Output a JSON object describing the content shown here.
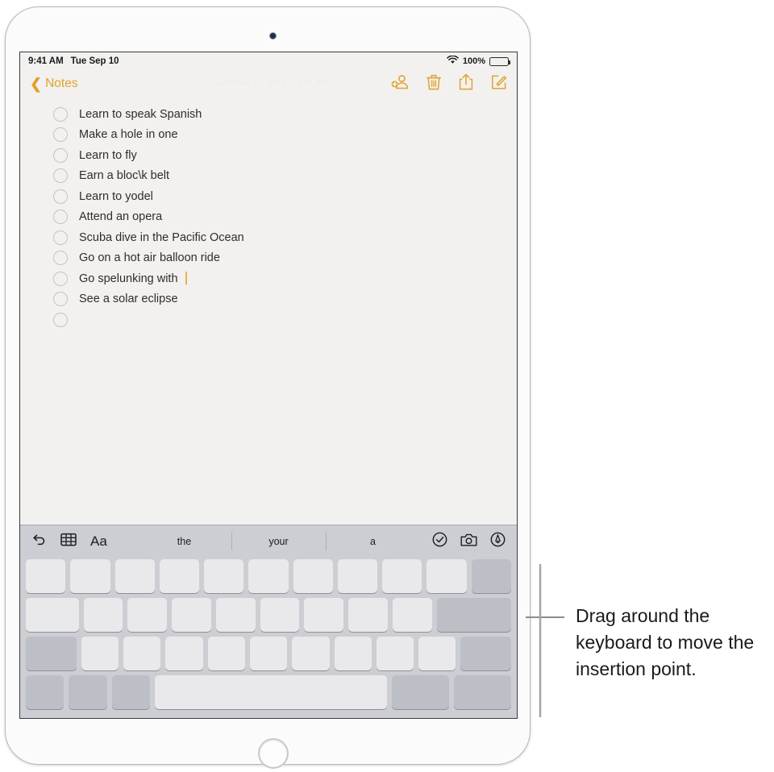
{
  "device": {
    "name": "iPad",
    "front_camera_icon": "camera-dot",
    "home_button_icon": "home-button"
  },
  "status_bar": {
    "time": "9:41 AM",
    "date": "Tue Sep 10",
    "wifi_icon": "wifi-icon",
    "battery_percent": "100%",
    "battery_icon": "battery-full-icon"
  },
  "nav_toolbar": {
    "back_label": "Notes",
    "back_chevron_icon": "chevron-left-icon",
    "accent_color": "#e0a32e",
    "actions": [
      {
        "name": "add-people-button",
        "icon": "add-person-icon"
      },
      {
        "name": "delete-button",
        "icon": "trash-icon"
      },
      {
        "name": "share-button",
        "icon": "share-icon"
      },
      {
        "name": "compose-button",
        "icon": "compose-icon"
      }
    ]
  },
  "note": {
    "date_watermark": "September 10, 2019 at 9:41 AM",
    "checklist": [
      {
        "text": "Learn to speak Spanish",
        "checked": false
      },
      {
        "text": "Make a hole in one",
        "checked": false
      },
      {
        "text": "Learn to fly",
        "checked": false
      },
      {
        "text": "Earn a bloc\\k belt",
        "checked": false
      },
      {
        "text": "Learn to yodel",
        "checked": false
      },
      {
        "text": "Attend an opera",
        "checked": false
      },
      {
        "text": "Scuba dive in the Pacific Ocean",
        "checked": false
      },
      {
        "text": "Go on a hot air balloon ride",
        "checked": false
      },
      {
        "text": "Go spelunking with ",
        "checked": false,
        "cursor": true
      },
      {
        "text": "See a solar eclipse",
        "checked": false
      },
      {
        "text": "",
        "checked": false
      }
    ],
    "cursor_color": "#e6b34a"
  },
  "keyboard": {
    "shortcut_bar": {
      "left_icons": [
        {
          "name": "undo-icon",
          "label": "undo-icon"
        },
        {
          "name": "table-icon",
          "label": "table-icon"
        },
        {
          "name": "text-format-button",
          "label": "Aa"
        }
      ],
      "predictions": [
        "the",
        "your",
        "a"
      ],
      "right_icons": [
        {
          "name": "checklist-icon",
          "label": "checklist-icon"
        },
        {
          "name": "camera-icon",
          "label": "camera-icon"
        },
        {
          "name": "markup-pen-icon",
          "label": "markup-pen-icon"
        }
      ]
    },
    "rows": [
      {
        "keys": [
          {
            "w": 1,
            "dark": false
          },
          {
            "w": 1,
            "dark": false
          },
          {
            "w": 1,
            "dark": false
          },
          {
            "w": 1,
            "dark": false
          },
          {
            "w": 1,
            "dark": false
          },
          {
            "w": 1,
            "dark": false
          },
          {
            "w": 1,
            "dark": false
          },
          {
            "w": 1,
            "dark": false
          },
          {
            "w": 1,
            "dark": false
          },
          {
            "w": 1,
            "dark": false
          },
          {
            "w": 1,
            "dark": true
          }
        ]
      },
      {
        "keys": [
          {
            "w": 1.35,
            "dark": false
          },
          {
            "w": 1,
            "dark": false
          },
          {
            "w": 1,
            "dark": false
          },
          {
            "w": 1,
            "dark": false
          },
          {
            "w": 1,
            "dark": false
          },
          {
            "w": 1,
            "dark": false
          },
          {
            "w": 1,
            "dark": false
          },
          {
            "w": 1,
            "dark": false
          },
          {
            "w": 1,
            "dark": false
          },
          {
            "w": 1.9,
            "dark": true
          }
        ]
      },
      {
        "keys": [
          {
            "w": 1.35,
            "dark": true
          },
          {
            "w": 1,
            "dark": false
          },
          {
            "w": 1,
            "dark": false
          },
          {
            "w": 1,
            "dark": false
          },
          {
            "w": 1,
            "dark": false
          },
          {
            "w": 1,
            "dark": false
          },
          {
            "w": 1,
            "dark": false
          },
          {
            "w": 1,
            "dark": false
          },
          {
            "w": 1,
            "dark": false
          },
          {
            "w": 1,
            "dark": false
          },
          {
            "w": 1.35,
            "dark": true
          }
        ]
      },
      {
        "keys": [
          {
            "w": 1,
            "dark": true
          },
          {
            "w": 1,
            "dark": true
          },
          {
            "w": 1,
            "dark": true
          },
          {
            "w": 6.1,
            "dark": false
          },
          {
            "w": 1.5,
            "dark": true
          },
          {
            "w": 1.5,
            "dark": true
          }
        ]
      }
    ]
  },
  "callout": {
    "text": "Drag around the keyboard to move the insertion point.",
    "leader_line": "leader-line"
  }
}
